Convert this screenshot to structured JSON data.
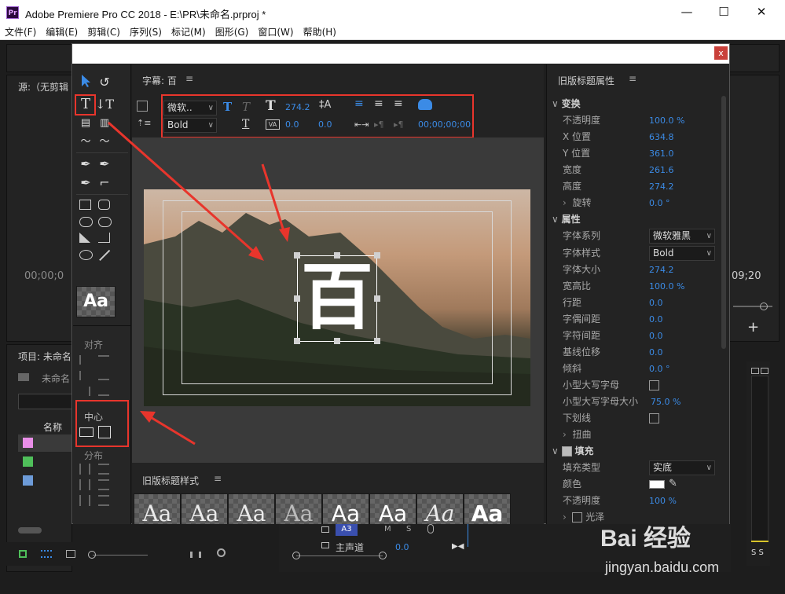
{
  "window": {
    "title": "Adobe Premiere Pro CC 2018 - E:\\PR\\未命名.prproj *",
    "logo": "Pr",
    "min": "—",
    "max": "☐",
    "close": "✕"
  },
  "menu": [
    "文件(F)",
    "编辑(E)",
    "剪辑(C)",
    "序列(S)",
    "标记(M)",
    "图形(G)",
    "窗口(W)",
    "帮助(H)"
  ],
  "bg": {
    "source_tab": "源:（无剪辑",
    "timecode_left": "00;00;0",
    "timecode_right": "09;20",
    "project_tab": "项目: 未命名",
    "project_file": "未命名",
    "name_col": "名称",
    "plus": "+",
    "audio_track": "A3",
    "main_track": "主声道",
    "main_value": "0.0",
    "ss": "S S"
  },
  "dialog": {
    "close": "x",
    "title_panel": "字幕: 百",
    "toolbar": {
      "font": "微软..",
      "style": "Bold",
      "size": "274.2",
      "kern": "0.0",
      "lead": "0.0",
      "timecode": "00;00;00;00"
    },
    "canvas_text": "百",
    "align_title": "对齐",
    "center_title": "中心",
    "distribute_title": "分布",
    "aa": "Aa",
    "styles_title": "旧版标题样式",
    "style_swatches": [
      "Aa",
      "Aa",
      "Aa",
      "Aa",
      "Aa",
      "Aa",
      "Aa",
      "Aa"
    ]
  },
  "props": {
    "title": "旧版标题属性",
    "transform": "变换",
    "rows_transform": [
      {
        "label": "不透明度",
        "value": "100.0 %"
      },
      {
        "label": "X 位置",
        "value": "634.8"
      },
      {
        "label": "Y 位置",
        "value": "361.0"
      },
      {
        "label": "宽度",
        "value": "261.6"
      },
      {
        "label": "高度",
        "value": "274.2"
      },
      {
        "label": "旋转",
        "value": "0.0 °"
      }
    ],
    "attributes": "属性",
    "font_family_label": "字体系列",
    "font_family": "微软雅黑",
    "font_style_label": "字体样式",
    "font_style": "Bold",
    "rows_attr": [
      {
        "label": "字体大小",
        "value": "274.2"
      },
      {
        "label": "宽高比",
        "value": "100.0 %"
      },
      {
        "label": "行距",
        "value": "0.0"
      },
      {
        "label": "字偶间距",
        "value": "0.0"
      },
      {
        "label": "字符间距",
        "value": "0.0"
      },
      {
        "label": "基线位移",
        "value": "0.0"
      },
      {
        "label": "倾斜",
        "value": "0.0 °"
      }
    ],
    "smallcaps": "小型大写字母",
    "smallcaps_size_label": "小型大写字母大小",
    "smallcaps_size": "75.0 %",
    "underline": "下划线",
    "distort": "扭曲",
    "fill": "填充",
    "fill_type_label": "填充类型",
    "fill_type": "实底",
    "color_label": "颜色",
    "fill_opacity_label": "不透明度",
    "fill_opacity": "100 %",
    "sheen": "光泽"
  },
  "watermark": {
    "brand": "Bai 经验",
    "url": "jingyan.baidu.com"
  },
  "colors": {
    "accent": "#3b8be6",
    "highlight": "#e8352c",
    "bg": "#232323"
  }
}
